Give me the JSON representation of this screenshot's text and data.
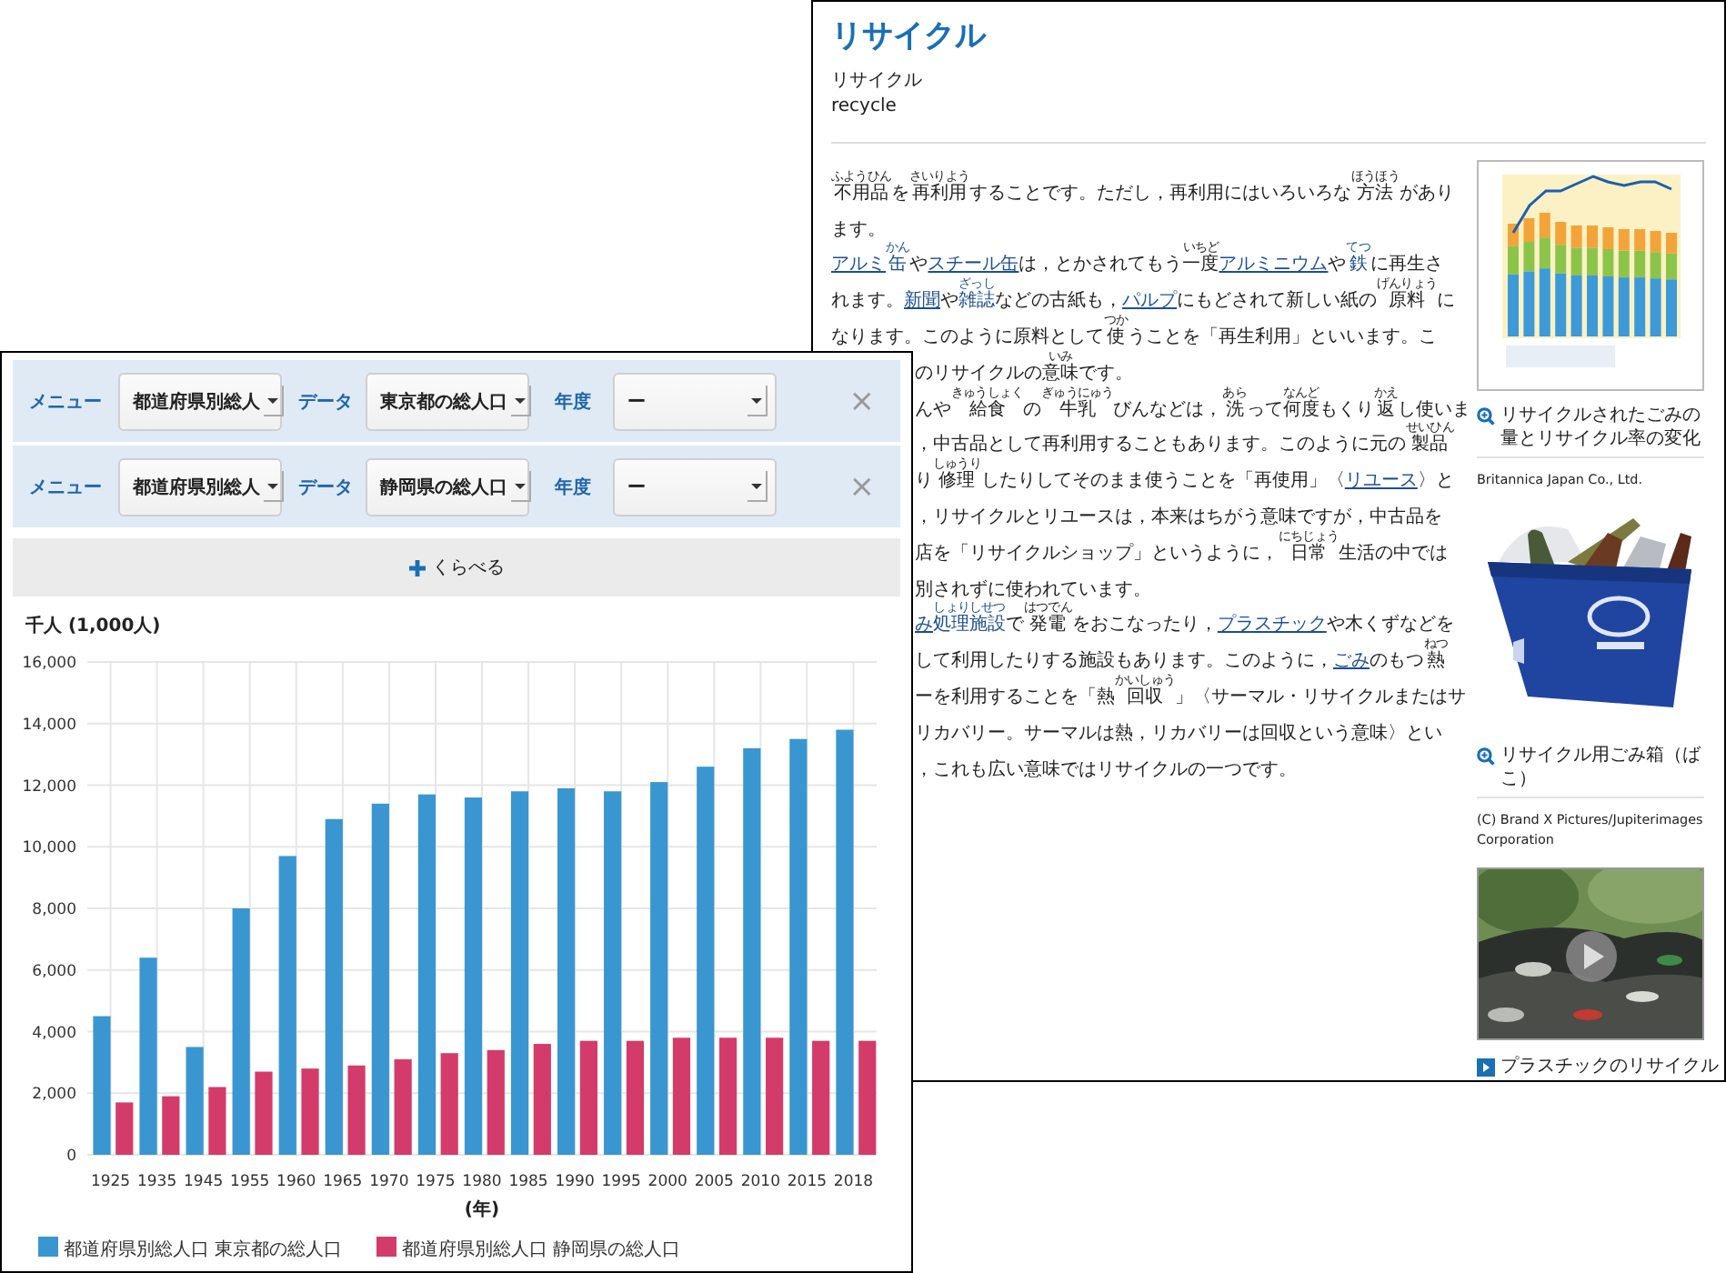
{
  "article": {
    "title": "リサイクル",
    "reading": "リサイクル",
    "english": "recycle",
    "lines": [
      {
        "segments": [
          {
            "text": "不用品",
            "ruby": "ふようひん",
            "link": false
          },
          {
            "text": "を",
            "link": false
          },
          {
            "text": "再利用",
            "ruby": "さいりよう",
            "link": false
          },
          {
            "text": "することです。ただし，再利用にはいろいろな",
            "link": false
          },
          {
            "text": "方法",
            "ruby": "ほうほう",
            "link": false
          },
          {
            "text": "があり",
            "link": false
          }
        ]
      },
      {
        "segments": [
          {
            "text": "ます。",
            "link": false
          }
        ]
      },
      {
        "segments": [
          {
            "text": "アルミ",
            "link": true
          },
          {
            "text": "缶",
            "ruby": "かん",
            "link": true
          },
          {
            "text": "や",
            "link": false
          },
          {
            "text": "スチール缶",
            "link": true
          },
          {
            "text": "は，とかされてもう",
            "link": false
          },
          {
            "text": "一度",
            "ruby": "いちど",
            "link": false
          },
          {
            "text": "アルミニウム",
            "link": true
          },
          {
            "text": "や",
            "link": false
          },
          {
            "text": "鉄",
            "ruby": "てつ",
            "link": true
          },
          {
            "text": "に再生さ",
            "link": false
          }
        ]
      },
      {
        "segments": [
          {
            "text": "れます。",
            "link": false
          },
          {
            "text": "新聞",
            "link": true
          },
          {
            "text": "や",
            "link": false
          },
          {
            "text": "雑誌",
            "ruby": "ざっし",
            "link": true
          },
          {
            "text": "などの古紙も，",
            "link": false
          },
          {
            "text": "パルプ",
            "link": true
          },
          {
            "text": "にもどされて新しい紙の",
            "link": false
          },
          {
            "text": "原料",
            "ruby": "げんりょう",
            "link": false
          },
          {
            "text": "に",
            "link": false
          }
        ]
      },
      {
        "segments": [
          {
            "text": "なります。このように原料として",
            "link": false
          },
          {
            "text": "使",
            "ruby": "つか",
            "link": false
          },
          {
            "text": "うことを「再生利用」といいます。こ",
            "link": false
          }
        ]
      }
    ],
    "covered_lines": [
      {
        "segments": [
          {
            "text": "のリサイクルの",
            "link": false
          },
          {
            "text": "意味",
            "ruby": "いみ",
            "link": false
          },
          {
            "text": "です。",
            "link": false
          }
        ]
      },
      {
        "segments": [
          {
            "text": "んや",
            "link": false
          },
          {
            "text": "給食",
            "ruby": "きゅうしょく",
            "link": false
          },
          {
            "text": "の",
            "link": false
          },
          {
            "text": "牛乳",
            "ruby": "ぎゅうにゅう",
            "link": false
          },
          {
            "text": "びんなどは，",
            "link": false
          },
          {
            "text": "洗",
            "ruby": "あら",
            "link": false
          },
          {
            "text": "って",
            "link": false
          },
          {
            "text": "何度",
            "ruby": "なんど",
            "link": false
          },
          {
            "text": "もくり",
            "link": false
          },
          {
            "text": "返",
            "ruby": "かえ",
            "link": false
          },
          {
            "text": "し使いま",
            "link": false
          }
        ]
      },
      {
        "segments": [
          {
            "text": "，中古品として再利用することもあります。このように元の",
            "link": false
          },
          {
            "text": "製品",
            "ruby": "せいひん",
            "link": false
          }
        ]
      },
      {
        "segments": [
          {
            "text": "り",
            "link": false
          },
          {
            "text": "修理",
            "ruby": "しゅうり",
            "link": false
          },
          {
            "text": "したりしてそのまま使うことを「再使用」〈",
            "link": false
          },
          {
            "text": "リユース",
            "link": true
          },
          {
            "text": "〉と",
            "link": false
          }
        ]
      },
      {
        "segments": [
          {
            "text": "，リサイクルとリユースは，本来はちがう意味ですが，中古品を",
            "link": false
          }
        ]
      },
      {
        "segments": [
          {
            "text": "店を「リサイクルショップ」というように，",
            "link": false
          },
          {
            "text": "日常",
            "ruby": "にちじょう",
            "link": false
          },
          {
            "text": "生活の中では",
            "link": false
          }
        ]
      },
      {
        "segments": [
          {
            "text": "別されずに使われています。",
            "link": false
          }
        ]
      },
      {
        "segments": [
          {
            "text": "み",
            "link": true
          },
          {
            "text": "処理施設",
            "ruby": "しょりしせつ",
            "link": true
          },
          {
            "text": "で",
            "link": false
          },
          {
            "text": "発電",
            "ruby": "はつでん",
            "link": false
          },
          {
            "text": "をおこなったり，",
            "link": false
          },
          {
            "text": "プラスチック",
            "link": true
          },
          {
            "text": "や木くずなどを",
            "link": false
          }
        ]
      },
      {
        "segments": [
          {
            "text": "して利用したりする施設もあります。このように，",
            "link": false
          },
          {
            "text": "ごみ",
            "link": true
          },
          {
            "text": "のもつ",
            "link": false
          },
          {
            "text": "熱",
            "ruby": "ねつ",
            "link": false
          }
        ]
      },
      {
        "segments": [
          {
            "text": "ーを利用することを「熱",
            "link": false
          },
          {
            "text": "回収",
            "ruby": "かいしゅう",
            "link": false
          },
          {
            "text": "」〈サーマル・リサイクルまたはサ",
            "link": false
          }
        ]
      },
      {
        "segments": [
          {
            "text": "リカバリー。サーマルは熱，リカバリーは回収という意味〉とい",
            "link": false
          }
        ]
      },
      {
        "segments": [
          {
            "text": "，これも広い意味ではリサイクルの一つです。",
            "link": false
          }
        ]
      }
    ]
  },
  "sidebar": {
    "media": [
      {
        "kind": "figure",
        "caption": "リサイクルされたごみの量とリサイクル率の変化",
        "credit": "Britannica Japan Co., Ltd."
      },
      {
        "caption": "リサイクル用ごみ箱（ばこ）",
        "credit": "(C) Brand X Pictures/Jupiterimages Corporation"
      },
      {
        "kind": "video",
        "caption": "プラスチックのリサイクル"
      }
    ]
  },
  "filters": [
    {
      "menu_label": "メニュー",
      "menu": "都道府県別総人",
      "data_label": "データ",
      "data": "東京都の総人口",
      "year_label": "年度",
      "year": "ー",
      "remove": "×"
    },
    {
      "menu_label": "メニュー",
      "menu": "都道府県別総人",
      "data_label": "データ",
      "data": "静岡県の総人口",
      "year_label": "年度",
      "year": "ー",
      "remove": "×"
    }
  ],
  "compare_button": {
    "label": "くらべる"
  },
  "chart_data": {
    "type": "bar",
    "ylabel": "千人 (1,000人)",
    "xlabel": "(年)",
    "categories": [
      "1925",
      "1935",
      "1945",
      "1955",
      "1960",
      "1965",
      "1970",
      "1975",
      "1980",
      "1985",
      "1990",
      "1995",
      "2000",
      "2005",
      "2010",
      "2015",
      "2018"
    ],
    "series": [
      {
        "name": "都道府県別総人口 東京都の総人口",
        "color": "#3a96d0",
        "values": [
          4500,
          6400,
          3500,
          8000,
          9700,
          10900,
          11400,
          11700,
          11600,
          11800,
          11900,
          11800,
          12100,
          12600,
          13200,
          13500,
          13800
        ]
      },
      {
        "name": "都道府県別総人口 静岡県の総人口",
        "color": "#d33c6a",
        "values": [
          1700,
          1900,
          2200,
          2700,
          2800,
          2900,
          3100,
          3300,
          3400,
          3600,
          3700,
          3700,
          3800,
          3800,
          3800,
          3700,
          3700
        ]
      }
    ],
    "grid": true,
    "legend": true,
    "ylim": [
      0,
      16000
    ],
    "yticks": [
      {
        "value": 0,
        "label": "0"
      },
      {
        "value": 2000,
        "label": "2,000"
      },
      {
        "value": 4000,
        "label": "4,000"
      },
      {
        "value": 6000,
        "label": "6,000"
      },
      {
        "value": 8000,
        "label": "8,000"
      },
      {
        "value": 10000,
        "label": "10,000"
      },
      {
        "value": 12000,
        "label": "12,000"
      },
      {
        "value": 14000,
        "label": "14,000"
      },
      {
        "value": 16000,
        "label": "16,000"
      }
    ]
  }
}
